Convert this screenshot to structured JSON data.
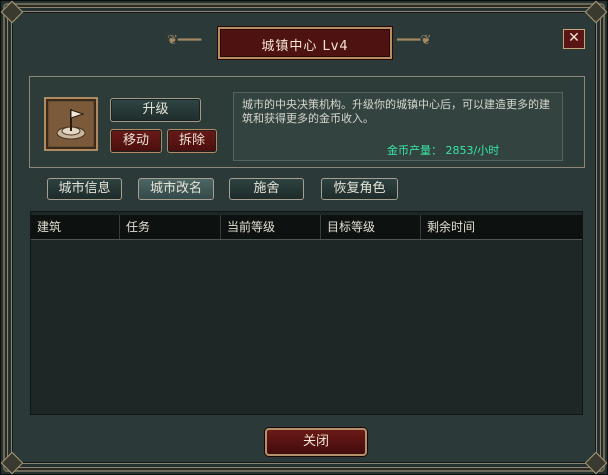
{
  "window": {
    "title": "城镇中心 Lv4",
    "close_glyph": "✕"
  },
  "building": {
    "icon": "town-center-flag-icon",
    "upgrade_label": "升级",
    "move_label": "移动",
    "demolish_label": "拆除",
    "description": "城市的中央决策机构。升级你的城镇中心后，可以建造更多的建筑和获得更多的金币收入。",
    "gold_output_label": "金币产量：",
    "gold_output_value": "2853/小时"
  },
  "tabs": [
    {
      "label": "城市信息",
      "active": false
    },
    {
      "label": "城市改名",
      "active": true
    },
    {
      "label": "施舍",
      "active": false
    },
    {
      "label": "恢复角色",
      "active": false
    }
  ],
  "table": {
    "columns": [
      "建筑",
      "任务",
      "当前等级",
      "目标等级",
      "剩余时间"
    ],
    "rows": []
  },
  "footer": {
    "close_label": "关闭"
  },
  "colors": {
    "accent_red": "#4e1210",
    "gold_text": "#38e6a6",
    "panel_bg": "#2b3a38"
  }
}
